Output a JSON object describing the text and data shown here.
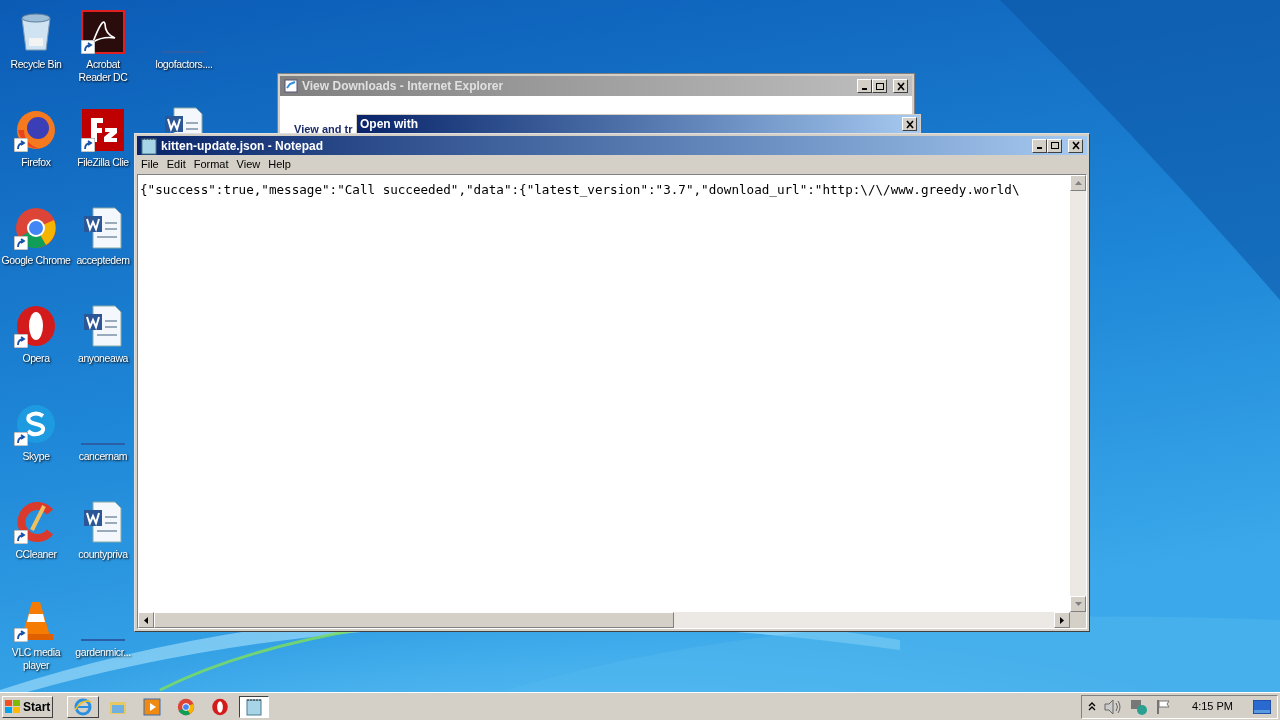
{
  "desktop_icons": [
    {
      "label": "Recycle Bin",
      "kind": "recycle",
      "shortcut": false
    },
    {
      "label": "Acrobat Reader DC",
      "kind": "acrobat",
      "shortcut": true
    },
    {
      "label": "logofactors....",
      "kind": "thumb",
      "shortcut": false
    },
    {
      "label": "Firefox",
      "kind": "firefox",
      "shortcut": true
    },
    {
      "label": "FileZilla Clie",
      "kind": "filezilla",
      "shortcut": true
    },
    {
      "kind": "word"
    },
    {
      "label": "Google Chrome",
      "kind": "chrome",
      "shortcut": true
    },
    {
      "label": "acceptedem",
      "kind": "word",
      "shortcut": false
    },
    {
      "kind": "empty"
    },
    {
      "label": "Opera",
      "kind": "opera",
      "shortcut": true
    },
    {
      "label": "anyoneawa",
      "kind": "word",
      "shortcut": false
    },
    {
      "kind": "empty"
    },
    {
      "label": "Skype",
      "kind": "skype",
      "shortcut": true
    },
    {
      "label": "cancernam",
      "kind": "thumb",
      "shortcut": false
    },
    {
      "kind": "empty"
    },
    {
      "label": "CCleaner",
      "kind": "ccleaner",
      "shortcut": true
    },
    {
      "label": "countypriva",
      "kind": "word",
      "shortcut": false
    },
    {
      "kind": "empty"
    },
    {
      "label": "VLC media player",
      "kind": "vlc",
      "shortcut": true
    },
    {
      "label": "gardenmicr...",
      "kind": "thumb",
      "shortcut": false
    }
  ],
  "ie_window": {
    "title": "View Downloads - Internet Explorer",
    "heading": "View and tr"
  },
  "open_with_dialog": {
    "title": "Open with"
  },
  "notepad": {
    "title": "kitten-update.json - Notepad",
    "menu": [
      "File",
      "Edit",
      "Format",
      "View",
      "Help"
    ],
    "content": "{\"success\":true,\"message\":\"Call succeeded\",\"data\":{\"latest_version\":\"3.7\",\"download_url\":\"http:\\/\\/www.greedy.world\\"
  },
  "taskbar": {
    "start": "Start",
    "items": [
      {
        "kind": "ie",
        "selected": false
      },
      {
        "kind": "folder",
        "selected": false
      },
      {
        "kind": "media",
        "selected": false
      },
      {
        "kind": "chrome",
        "selected": false
      },
      {
        "kind": "opera",
        "selected": false
      },
      {
        "kind": "notepad",
        "selected": true
      }
    ],
    "clock": "4:15 PM"
  }
}
